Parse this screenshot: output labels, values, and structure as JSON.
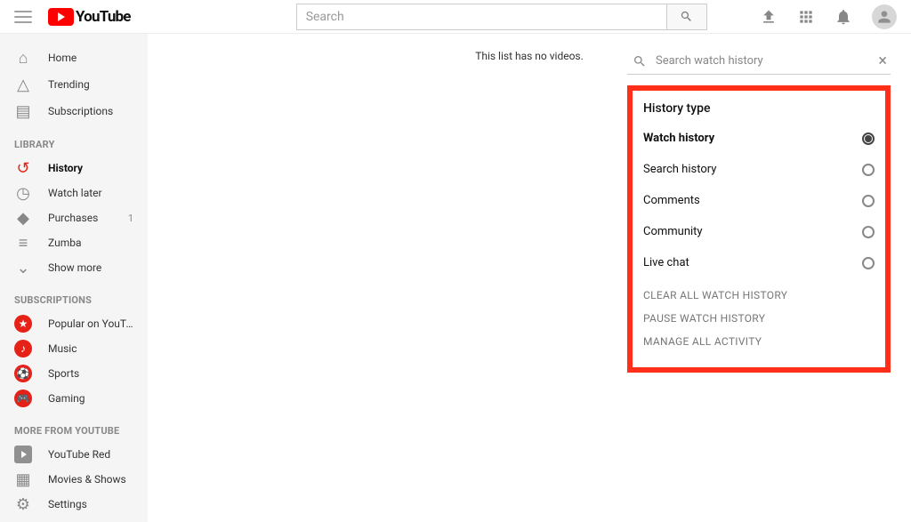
{
  "header": {
    "logo_text": "YouTube",
    "search_placeholder": "Search"
  },
  "sidebar": {
    "top": [
      {
        "id": "home",
        "label": "Home",
        "glyph": "⌂"
      },
      {
        "id": "trending",
        "label": "Trending",
        "glyph": "△"
      },
      {
        "id": "subscriptions",
        "label": "Subscriptions",
        "glyph": "▤"
      }
    ],
    "library_head": "Library",
    "library": [
      {
        "id": "history",
        "label": "History",
        "glyph": "↺",
        "active": true
      },
      {
        "id": "watch-later",
        "label": "Watch later",
        "glyph": "◷"
      },
      {
        "id": "purchases",
        "label": "Purchases",
        "glyph": "◆",
        "badge": "1"
      },
      {
        "id": "zumba",
        "label": "Zumba",
        "glyph": "≡"
      },
      {
        "id": "show-more",
        "label": "Show more",
        "glyph": "⌄"
      }
    ],
    "subs_head": "Subscriptions",
    "subs": [
      {
        "id": "popular",
        "label": "Popular on YouTu...",
        "chip": "★"
      },
      {
        "id": "music",
        "label": "Music",
        "chip": "♪"
      },
      {
        "id": "sports",
        "label": "Sports",
        "chip": "⚽"
      },
      {
        "id": "gaming",
        "label": "Gaming",
        "chip": "🎮"
      }
    ],
    "more_head": "More from YouTube",
    "more": [
      {
        "id": "youtube-red",
        "label": "YouTube Red",
        "kind": "play"
      },
      {
        "id": "movies-shows",
        "label": "Movies & Shows",
        "kind": "film"
      },
      {
        "id": "settings",
        "label": "Settings",
        "kind": "gear"
      }
    ]
  },
  "main": {
    "empty_message": "This list has no videos."
  },
  "history_panel": {
    "search_placeholder": "Search watch history",
    "title": "History type",
    "options": [
      {
        "id": "watch",
        "label": "Watch history",
        "selected": true
      },
      {
        "id": "search",
        "label": "Search history",
        "selected": false
      },
      {
        "id": "comments",
        "label": "Comments",
        "selected": false
      },
      {
        "id": "community",
        "label": "Community",
        "selected": false
      },
      {
        "id": "live-chat",
        "label": "Live chat",
        "selected": false
      }
    ],
    "links": [
      {
        "id": "clear",
        "label": "CLEAR ALL WATCH HISTORY"
      },
      {
        "id": "pause",
        "label": "PAUSE WATCH HISTORY"
      },
      {
        "id": "manage",
        "label": "MANAGE ALL ACTIVITY"
      }
    ]
  }
}
